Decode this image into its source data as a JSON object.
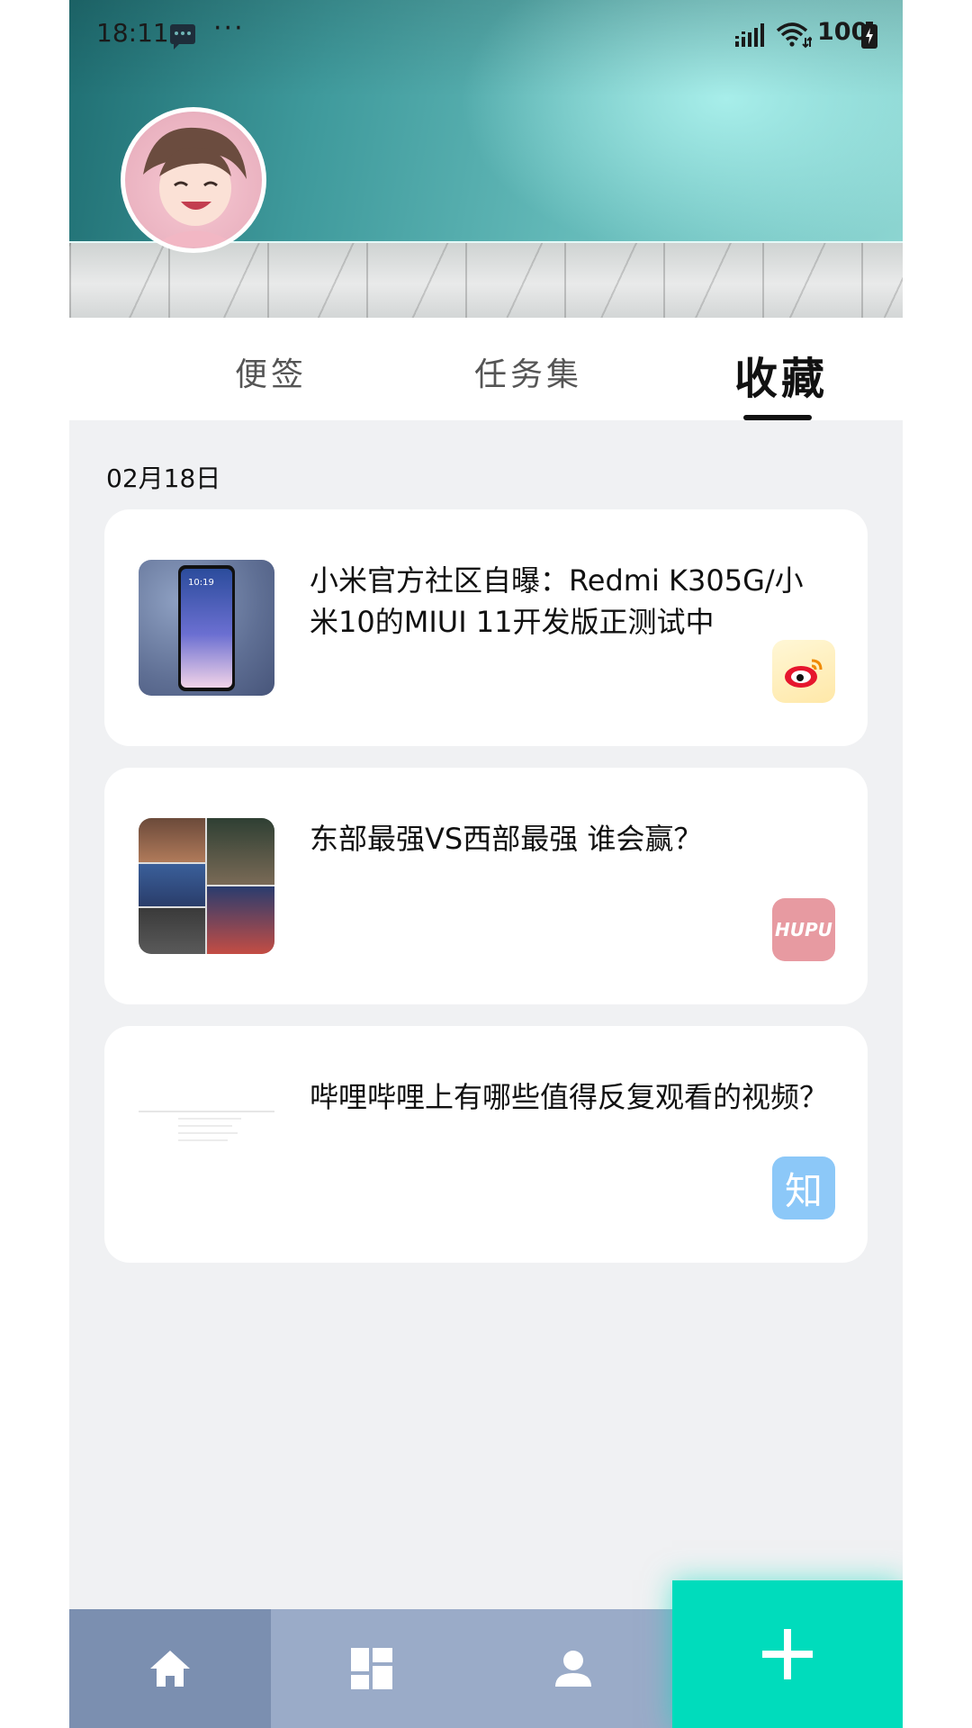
{
  "status": {
    "time": "18:11",
    "dots": "···",
    "battery": "100"
  },
  "tabs": [
    {
      "label": "便签",
      "active": false
    },
    {
      "label": "任务集",
      "active": false
    },
    {
      "label": "收藏",
      "active": true
    }
  ],
  "content": {
    "date": "02月18日",
    "cards": [
      {
        "title": "小米官方社区自曝：Redmi K305G/小米10的MIUI 11开发版正测试中",
        "source_icon": "weibo-icon",
        "thumb_inner": "10:19"
      },
      {
        "title": "东部最强VS西部最强 谁会赢？",
        "source_icon": "hupu-icon",
        "source_text": "HUPU"
      },
      {
        "title": "哔哩哔哩上有哪些值得反复观看的视频？",
        "source_icon": "zhihu-icon",
        "source_text": "知"
      }
    ]
  },
  "nav": {
    "items": [
      {
        "icon": "home-icon",
        "active": true
      },
      {
        "icon": "dashboard-icon",
        "active": false
      },
      {
        "icon": "person-icon",
        "active": false
      }
    ],
    "fab_icon": "plus-icon"
  },
  "colors": {
    "accent": "#00dcbc",
    "nav_active": "#7b8fb0",
    "nav_inactive": "#9aabc8",
    "background": "#f0f1f3"
  }
}
